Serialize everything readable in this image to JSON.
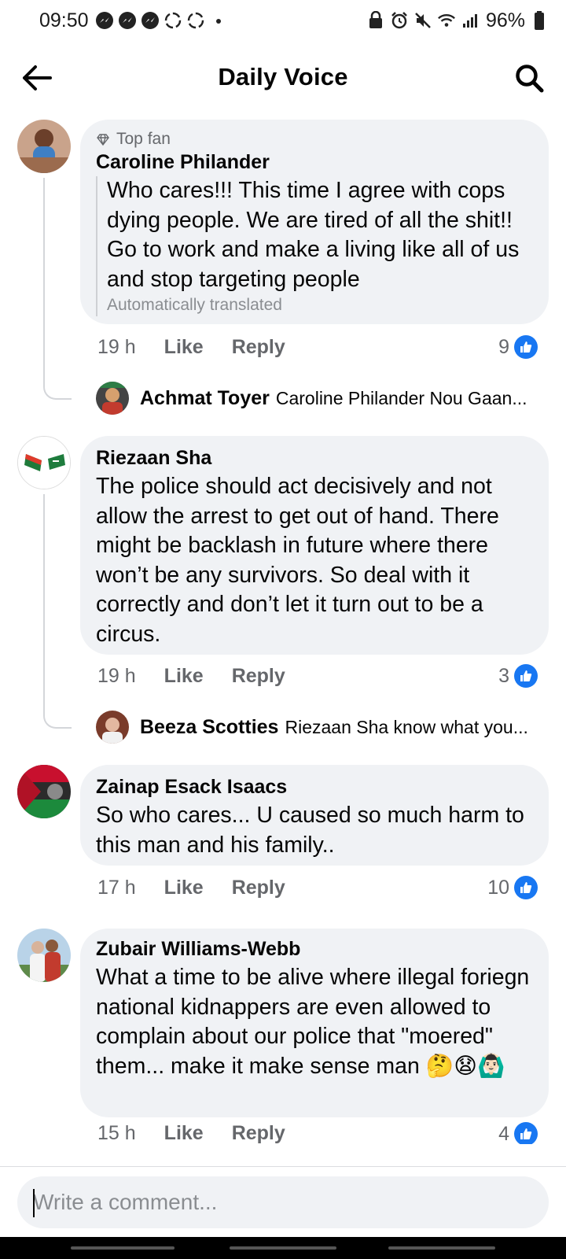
{
  "status_bar": {
    "time": "09:50",
    "battery": "96%"
  },
  "header": {
    "title": "Daily Voice"
  },
  "comments": [
    {
      "badge": "Top fan",
      "author": "Caroline Philander",
      "text": "Who cares!!! This time I agree with cops dying people. We are tired of all the shit!! Go to work and make a living like all of us and stop targeting people",
      "translated_note": "Automatically translated",
      "time": "19 h",
      "like": "Like",
      "reply": "Reply",
      "reactions": "9",
      "reply_preview": {
        "author": "Achmat Toyer",
        "snippet": "Caroline Philander Nou Gaan..."
      }
    },
    {
      "author": "Riezaan Sha",
      "text": "The police should act decisively and not allow the arrest to get out of hand. There might be backlash in future where there won’t be any survivors. So deal with it correctly and don’t let it turn out to be a circus.",
      "time": "19 h",
      "like": "Like",
      "reply": "Reply",
      "reactions": "3",
      "reply_preview": {
        "author": "Beeza Scotties",
        "snippet": "Riezaan Sha know what you..."
      }
    },
    {
      "author": "Zainap Esack Isaacs",
      "text": "So who cares... U caused so much harm to this man and his family..",
      "time": "17 h",
      "like": "Like",
      "reply": "Reply",
      "reactions": "10"
    },
    {
      "author": "Zubair Williams-Webb",
      "text": "What a time to be alive where illegal foriegn national kidnappers are even allowed to complain about our police that \"moered\" them... make it make sense man 🤔😧🙆🏻‍♂️",
      "time": "15 h",
      "like": "Like",
      "reply": "Reply",
      "reactions": "4"
    }
  ],
  "composer": {
    "placeholder": "Write a comment..."
  },
  "colors": {
    "accent": "#1877f2",
    "bubble": "#f0f2f5",
    "muted_text": "#65676b"
  }
}
